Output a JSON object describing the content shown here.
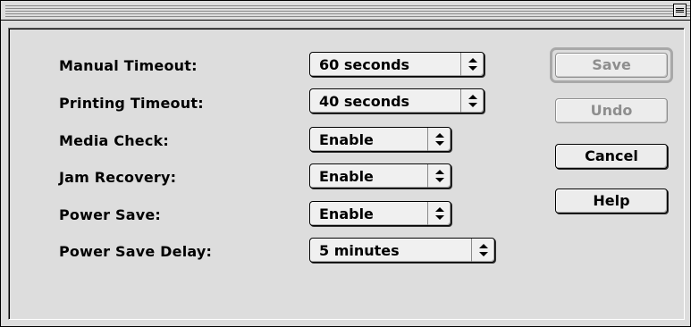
{
  "settings": {
    "rows": [
      {
        "label": "Manual Timeout:",
        "value": "60 seconds"
      },
      {
        "label": "Printing Timeout:",
        "value": "40 seconds"
      },
      {
        "label": "Media Check:",
        "value": "Enable"
      },
      {
        "label": "Jam Recovery:",
        "value": "Enable"
      },
      {
        "label": "Power Save:",
        "value": "Enable"
      },
      {
        "label": "Power Save Delay:",
        "value": "5 minutes"
      }
    ]
  },
  "buttons": {
    "save": "Save",
    "undo": "Undo",
    "cancel": "Cancel",
    "help": "Help"
  },
  "icons": {
    "collapse": "window-collapse-icon",
    "popup_arrows": "up-down-arrows-icon"
  },
  "colors": {
    "window_bg": "#dddddd",
    "disabled_text": "#8e8e8e"
  }
}
